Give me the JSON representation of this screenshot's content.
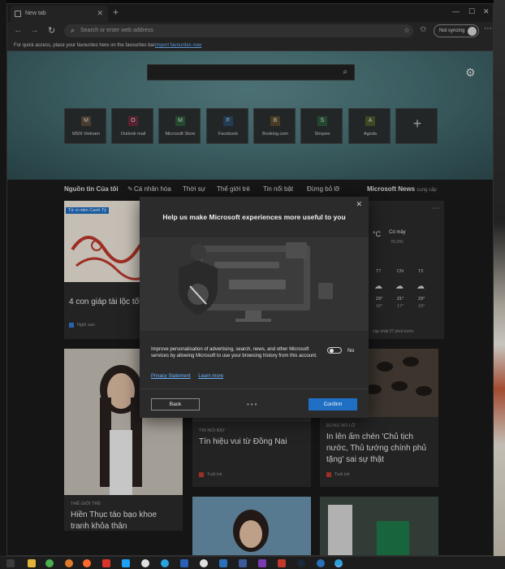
{
  "browser": {
    "tab_title": "New tab",
    "address_placeholder": "Search or enter web address",
    "profile_label": "Not syncing",
    "favbar_message": "For quick access, place your favourites here on the favourites bar.",
    "favbar_link": "Import favourites now"
  },
  "tiles": [
    {
      "letter": "M",
      "label": "MSN Vietnam",
      "color": "#5a4a3a"
    },
    {
      "letter": "O",
      "label": "Outlook mail",
      "color": "#6a2a3a"
    },
    {
      "letter": "M",
      "label": "Microsoft Store",
      "color": "#2e5a3a"
    },
    {
      "letter": "F",
      "label": "Facebook",
      "color": "#2a4a6a"
    },
    {
      "letter": "B",
      "label": "Booking.com",
      "color": "#5a4a2a"
    },
    {
      "letter": "S",
      "label": "Shopee",
      "color": "#2a5a3a"
    },
    {
      "letter": "A",
      "label": "Agoda",
      "color": "#4a5a2a"
    }
  ],
  "news_nav": {
    "items": [
      "Nguồn tin Của tôi",
      "Cá nhân hóa",
      "Thời sự",
      "Thế giới trẻ",
      "Tin nổi bật",
      "Đừng bỏ lỡ"
    ],
    "brand": "Microsoft News",
    "brand_suffix": "cung cấp"
  },
  "cards": {
    "top_left": {
      "badge": "Tử vi năm Canh Tý",
      "headline": "4 con giáp tài lộc tốt",
      "source": "Ngôi sao"
    },
    "bottom_left": {
      "category": "THẾ GIỚI TRẺ",
      "headline": "Hiền Thục táo bạo khoe tranh khỏa thân"
    },
    "middle": {
      "category": "TIN NỔI BẬT",
      "headline": "Tín hiệu vui từ Đồng Nai",
      "source": "Tuổi trẻ"
    },
    "right": {
      "category": "ĐỪNG BỎ LỠ",
      "headline": "In lên ấm chén 'Chủ tịch nước, Thủ tướng chính phủ tặng' sai sự thật",
      "source": "Tuổi trẻ"
    },
    "weather": {
      "temp_unit": "°C",
      "condition": "Có mây",
      "humidity": "70.0%",
      "days": [
        "T7",
        "CN",
        "T2"
      ],
      "highs": [
        "23°",
        "21°",
        "23°"
      ],
      "lows": [
        "18°",
        "17°",
        "18°"
      ],
      "updated": "cập nhật 27 phút trước"
    }
  },
  "modal": {
    "title": "Help us make Microsoft experiences more useful to you",
    "body": "Improve personalisation of advertising, search, news, and other Microsoft services by allowing Microsoft to use your browsing history from this account.",
    "toggle_label": "No",
    "privacy_link": "Privacy Statement",
    "learn_link": "Learn more",
    "back_label": "Back",
    "confirm_label": "Confirm",
    "close_icon": "close-icon"
  }
}
